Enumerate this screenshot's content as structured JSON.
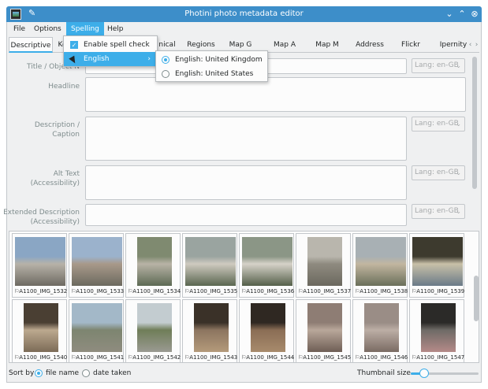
{
  "window": {
    "title": "Photini photo metadata editor",
    "min_glyph": "⌄",
    "max_glyph": "⌃",
    "close_glyph": "⊗",
    "pin_glyph": "✎"
  },
  "menubar": [
    "File",
    "Options",
    "Spelling",
    "Help"
  ],
  "tabs": [
    "Descriptive",
    "Ke",
    "nical",
    "Regions",
    "Map G",
    "Map A",
    "Map M",
    "Address",
    "Flickr",
    "Ipernity"
  ],
  "tab_scroll": {
    "left": "‹",
    "right": "›"
  },
  "form": {
    "title_label": "Title / Object N",
    "headline_label": "Headline",
    "description_label": "Description / Caption",
    "alt_text_label": "Alt Text\n(Accessibility)",
    "extended_label": "Extended Description\n(Accessibility)",
    "lang": "Lang: en-GB"
  },
  "spelling_menu": {
    "enable": "Enable spell check",
    "english": "English",
    "submenu_arrow": "›"
  },
  "english_submenu": {
    "uk": "English: United Kingdom",
    "us": "English: United States"
  },
  "thumbnails": [
    "A1100_IMG_1532",
    "A1100_IMG_1533",
    "A1100_IMG_1534",
    "A1100_IMG_1535",
    "A1100_IMG_1536",
    "A1100_IMG_1537",
    "A1100_IMG_1538",
    "A1100_IMG_1539",
    "A1100_IMG_1540",
    "A1100_IMG_1541",
    "A1100_IMG_1542",
    "A1100_IMG_1543",
    "A1100_IMG_1544",
    "A1100_IMG_1545",
    "A1100_IMG_1546",
    "A1100_IMG_1547"
  ],
  "thumb_flag_glyph": "⚐",
  "bottom": {
    "sort_by": "Sort by",
    "file_name": "file name",
    "date_taken": "date taken",
    "thumbnail_size": "Thumbnail size",
    "thumbnail_size_level": 0.2
  },
  "colors": {
    "accent": "#3daee9",
    "titlebar": "#3d8ec9"
  }
}
